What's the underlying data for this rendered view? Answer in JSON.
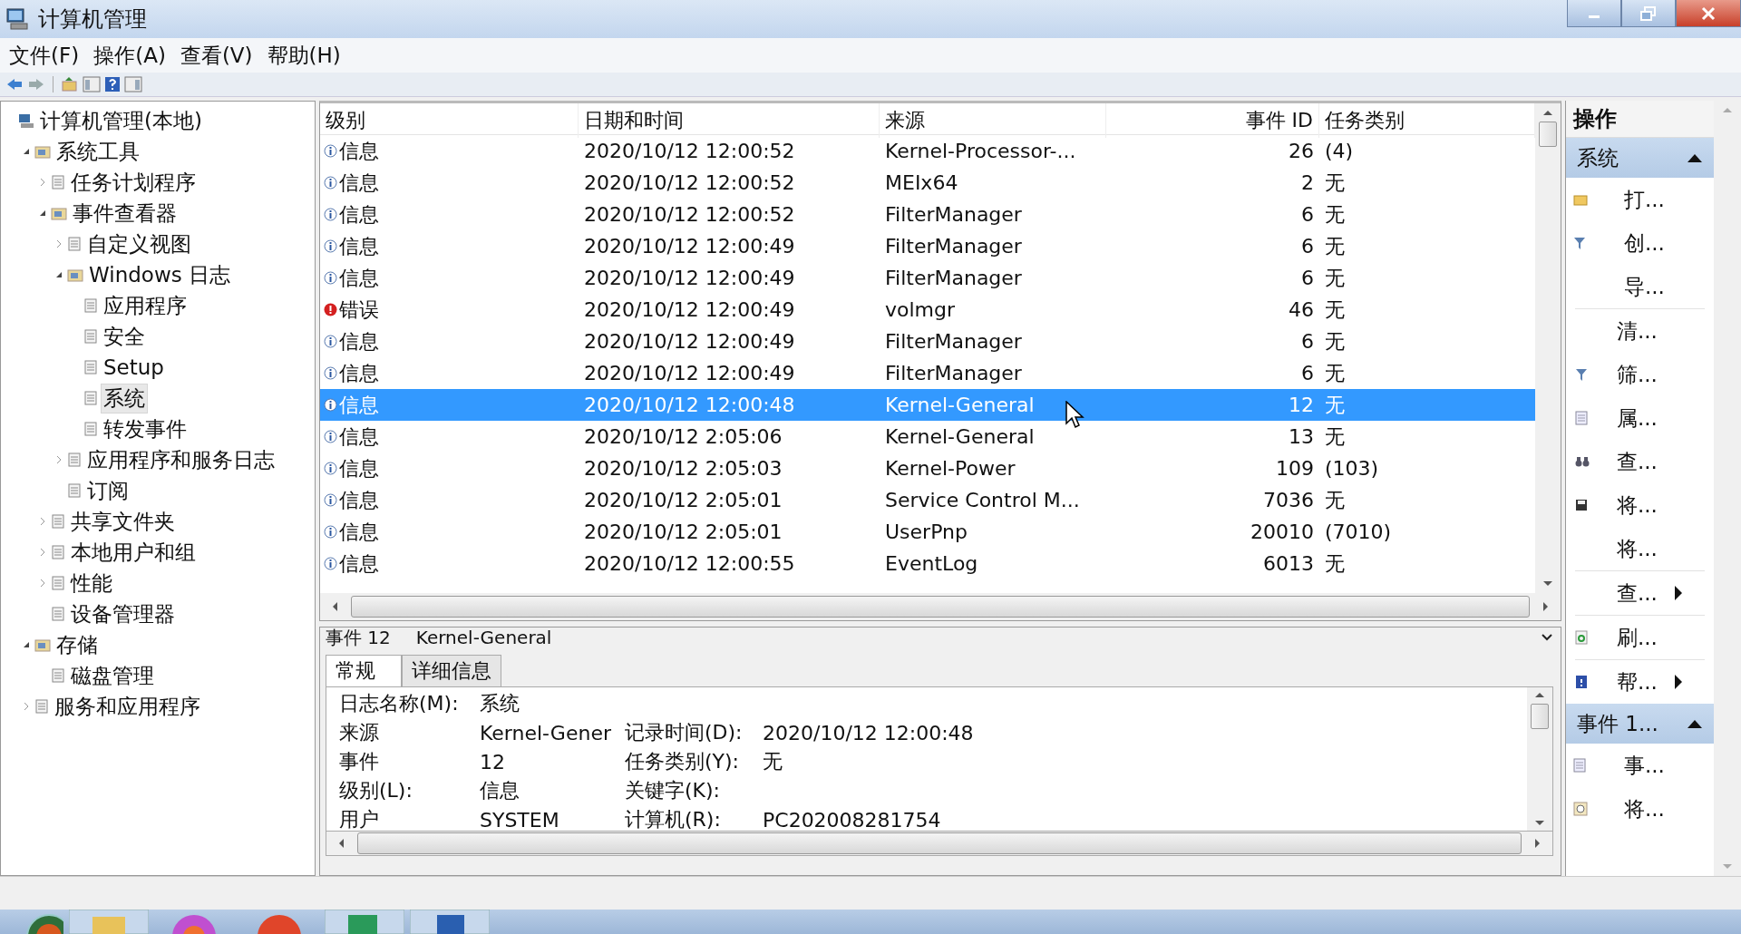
{
  "window": {
    "title": "计算机管理"
  },
  "menu": [
    "文件(F)",
    "操作(A)",
    "查看(V)",
    "帮助(H)"
  ],
  "tree": [
    {
      "label": "计算机管理(本地)",
      "selected": false,
      "children": [
        {
          "label": "系统工具",
          "selected": false,
          "expanded": true,
          "children": [
            {
              "label": "任务计划程序",
              "selected": false,
              "expanded": false
            },
            {
              "label": "事件查看器",
              "selected": false,
              "expanded": true,
              "children": [
                {
                  "label": "自定义视图",
                  "selected": false,
                  "expanded": false
                },
                {
                  "label": "Windows 日志",
                  "selected": false,
                  "expanded": true,
                  "children": [
                    {
                      "label": "应用程序",
                      "selected": false
                    },
                    {
                      "label": "安全",
                      "selected": false
                    },
                    {
                      "label": "Setup",
                      "selected": false
                    },
                    {
                      "label": "系统",
                      "selected": true
                    },
                    {
                      "label": "转发事件",
                      "selected": false
                    }
                  ]
                },
                {
                  "label": "应用程序和服务日志",
                  "selected": false,
                  "expanded": false
                },
                {
                  "label": "订阅",
                  "selected": false
                }
              ]
            },
            {
              "label": "共享文件夹",
              "selected": false,
              "expanded": false
            },
            {
              "label": "本地用户和组",
              "selected": false,
              "expanded": false
            },
            {
              "label": "性能",
              "selected": false,
              "expanded": false
            },
            {
              "label": "设备管理器",
              "selected": false
            }
          ]
        },
        {
          "label": "存储",
          "selected": false,
          "expanded": true,
          "children": [
            {
              "label": "磁盘管理",
              "selected": false
            }
          ]
        },
        {
          "label": "服务和应用程序",
          "selected": false,
          "expanded": false
        }
      ]
    }
  ],
  "table": {
    "columns": [
      "级别",
      "日期和时间",
      "来源",
      "事件 ID",
      "任务类别"
    ],
    "rows": [
      {
        "kind": "info",
        "severity": "信息",
        "date": "2020/10/12 12:00:52",
        "source": "Kernel-Processor-...",
        "event_id": "26",
        "task": "(4)",
        "selected": false
      },
      {
        "kind": "info",
        "severity": "信息",
        "date": "2020/10/12 12:00:52",
        "source": "MEIx64",
        "event_id": "2",
        "task": "无",
        "selected": false
      },
      {
        "kind": "info",
        "severity": "信息",
        "date": "2020/10/12 12:00:52",
        "source": "FilterManager",
        "event_id": "6",
        "task": "无",
        "selected": false
      },
      {
        "kind": "info",
        "severity": "信息",
        "date": "2020/10/12 12:00:49",
        "source": "FilterManager",
        "event_id": "6",
        "task": "无",
        "selected": false
      },
      {
        "kind": "info",
        "severity": "信息",
        "date": "2020/10/12 12:00:49",
        "source": "FilterManager",
        "event_id": "6",
        "task": "无",
        "selected": false
      },
      {
        "kind": "error",
        "severity": "错误",
        "date": "2020/10/12 12:00:49",
        "source": "volmgr",
        "event_id": "46",
        "task": "无",
        "selected": false
      },
      {
        "kind": "info",
        "severity": "信息",
        "date": "2020/10/12 12:00:49",
        "source": "FilterManager",
        "event_id": "6",
        "task": "无",
        "selected": false
      },
      {
        "kind": "info",
        "severity": "信息",
        "date": "2020/10/12 12:00:49",
        "source": "FilterManager",
        "event_id": "6",
        "task": "无",
        "selected": false
      },
      {
        "kind": "info",
        "severity": "信息",
        "date": "2020/10/12 12:00:48",
        "source": "Kernel-General",
        "event_id": "12",
        "task": "无",
        "selected": true
      },
      {
        "kind": "info",
        "severity": "信息",
        "date": "2020/10/12 2:05:06",
        "source": "Kernel-General",
        "event_id": "13",
        "task": "无",
        "selected": false
      },
      {
        "kind": "info",
        "severity": "信息",
        "date": "2020/10/12 2:05:03",
        "source": "Kernel-Power",
        "event_id": "109",
        "task": "(103)",
        "selected": false
      },
      {
        "kind": "info",
        "severity": "信息",
        "date": "2020/10/12 2:05:01",
        "source": "Service Control M...",
        "event_id": "7036",
        "task": "无",
        "selected": false
      },
      {
        "kind": "info",
        "severity": "信息",
        "date": "2020/10/12 2:05:01",
        "source": "UserPnp",
        "event_id": "20010",
        "task": "(7010)",
        "selected": false
      },
      {
        "kind": "info",
        "severity": "信息",
        "date": "2020/10/12 12:00:55",
        "source": "EventLog",
        "event_id": "6013",
        "task": "无",
        "selected": false
      }
    ]
  },
  "detail": {
    "title": "事件 12",
    "source": "Kernel-General",
    "tabs": [
      {
        "label": "常规",
        "selected": true
      },
      {
        "label": "详细信息",
        "selected": false
      }
    ],
    "fields": [
      {
        "label": "日志名称(M):",
        "value": "系统"
      },
      {
        "label": "来源",
        "value": "Kernel-Gener",
        "label_2": "记录时间(D):",
        "value_2": "2020/10/12 12:00:48"
      },
      {
        "label": "事件",
        "value": "12",
        "label_2": "任务类别(Y):",
        "value_2": "无"
      },
      {
        "label": "级别(L):",
        "value": "信息",
        "label_2": "关键字(K):"
      },
      {
        "label": "用户",
        "value": "SYSTEM",
        "label_2": "计算机(R):",
        "value_2": "PC202008281754"
      }
    ]
  },
  "actions": {
    "title": "操作",
    "sections": [
      {
        "title": "系统",
        "expanded": true,
        "groups": [
          [
            {
              "label": "打...",
              "submenu": false
            },
            {
              "label": "创...",
              "submenu": false
            },
            {
              "label": "导...",
              "submenu": false
            }
          ],
          [
            {
              "label": "清...",
              "submenu": false
            },
            {
              "label": "筛...",
              "submenu": false
            },
            {
              "label": "属...",
              "submenu": false
            },
            {
              "label": "查...",
              "submenu": false
            },
            {
              "label": "将...",
              "submenu": false
            },
            {
              "label": "将...",
              "submenu": false
            }
          ],
          [
            {
              "label": "查...",
              "submenu": true
            }
          ],
          [
            {
              "label": "刷...",
              "submenu": false
            }
          ],
          [
            {
              "label": "帮...",
              "submenu": true
            }
          ]
        ]
      },
      {
        "title": "事件 1...",
        "expanded": true,
        "groups": [
          [
            {
              "label": "事...",
              "submenu": false
            },
            {
              "label": "将...",
              "submenu": false
            }
          ]
        ]
      }
    ]
  }
}
